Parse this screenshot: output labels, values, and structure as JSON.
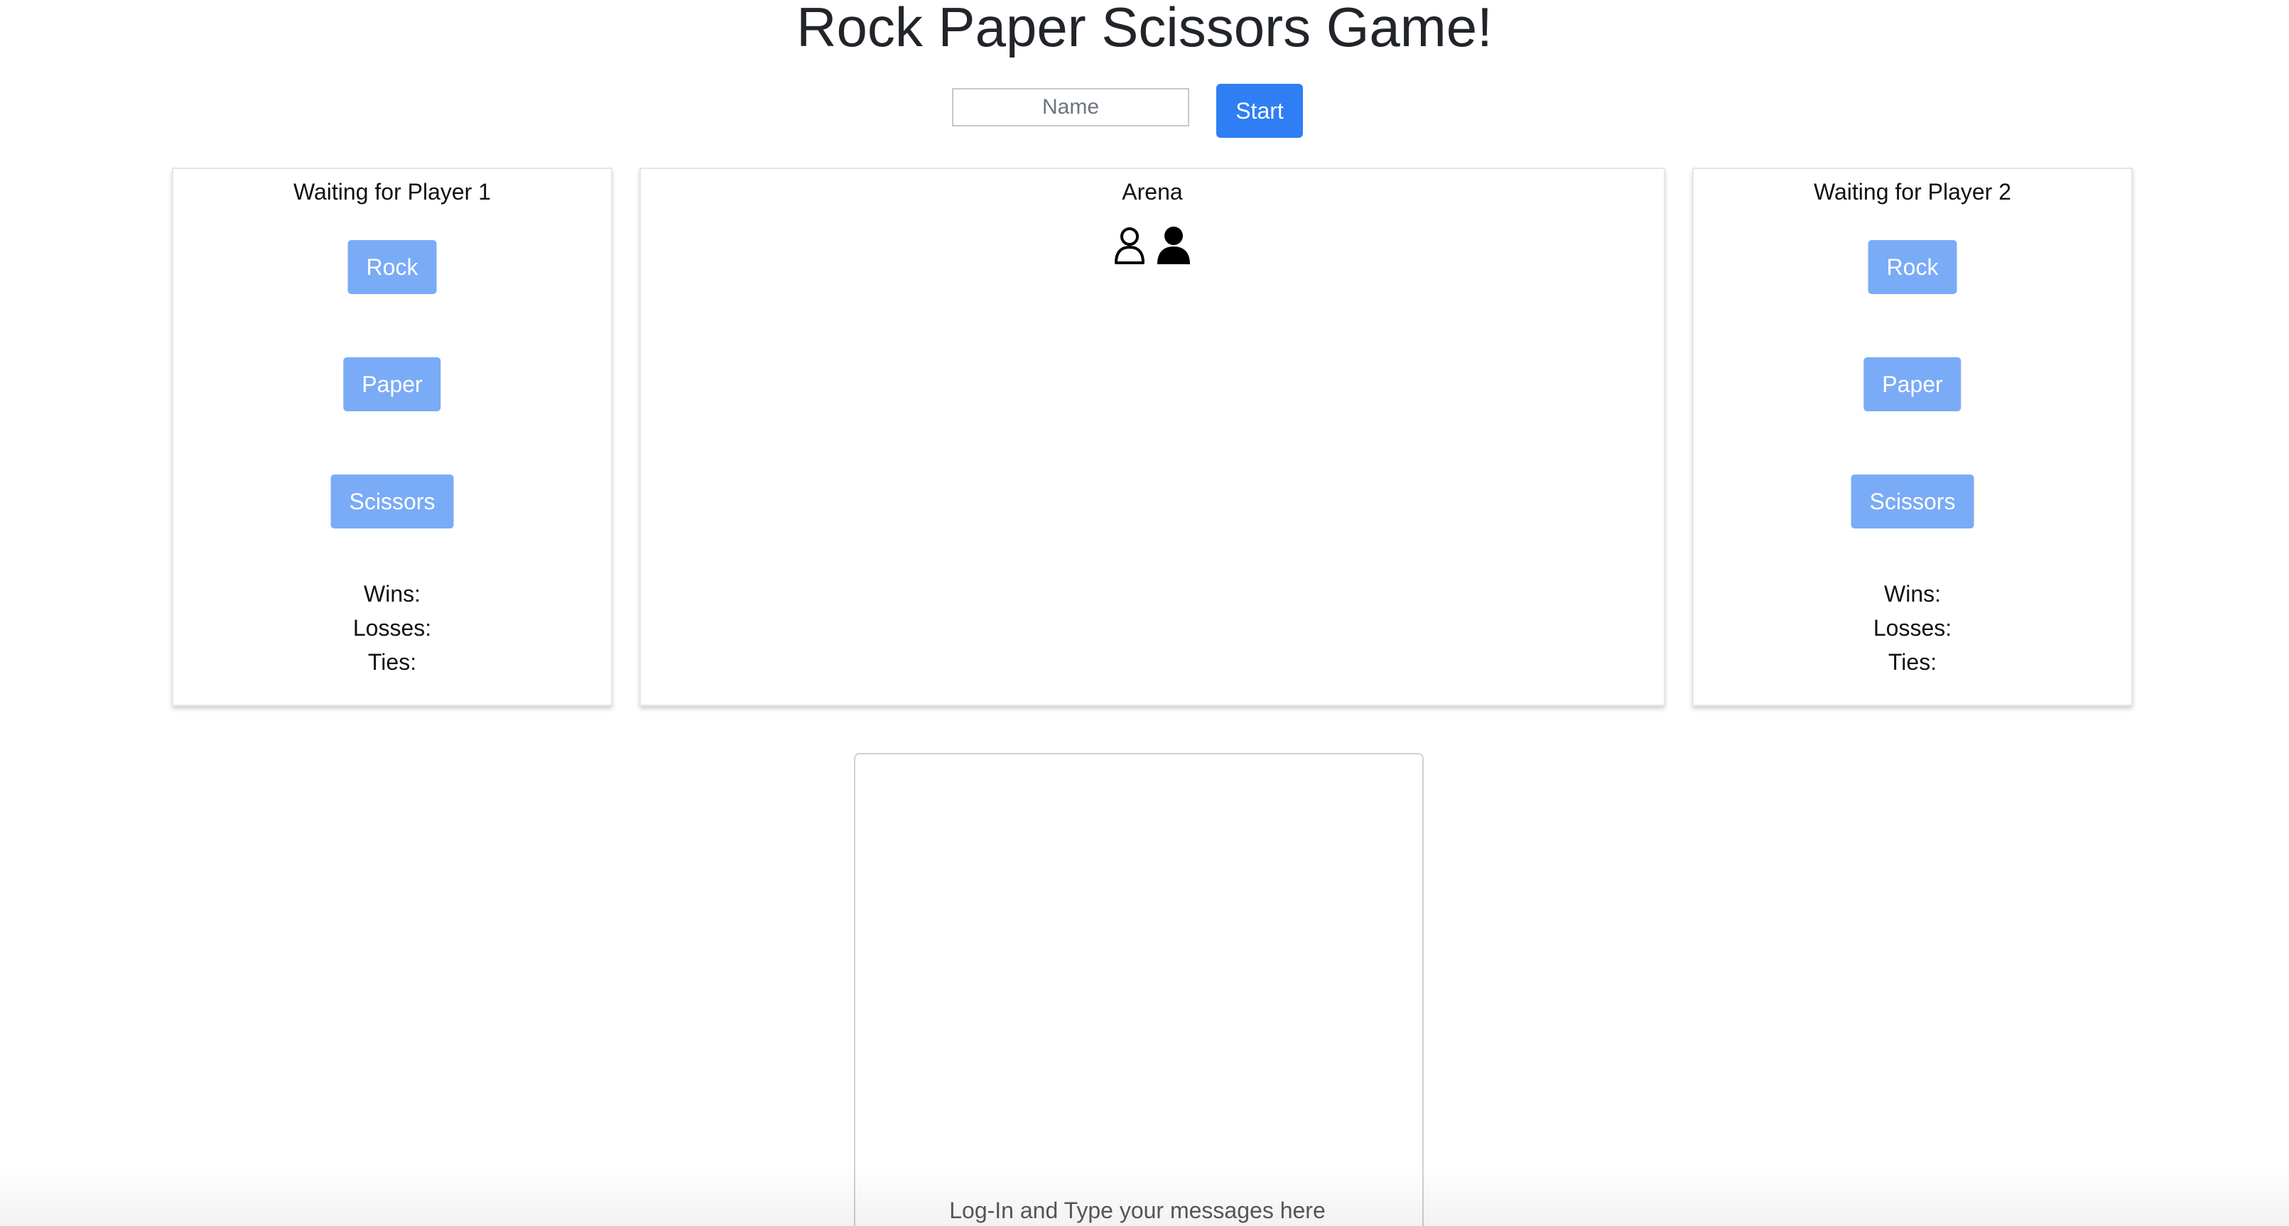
{
  "header": {
    "title": "Rock Paper Scissors Game!",
    "name_placeholder": "Name",
    "start_label": "Start"
  },
  "player1": {
    "status": "Waiting for Player 1",
    "moves": [
      "Rock",
      "Paper",
      "Scissors"
    ],
    "wins_label": "Wins:",
    "losses_label": "Losses:",
    "ties_label": "Ties:"
  },
  "arena": {
    "title": "Arena",
    "icons": [
      "user-outline-icon",
      "user-filled-icon"
    ]
  },
  "player2": {
    "status": "Waiting for Player 2",
    "moves": [
      "Rock",
      "Paper",
      "Scissors"
    ],
    "wins_label": "Wins:",
    "losses_label": "Losses:",
    "ties_label": "Ties:"
  },
  "chat": {
    "hint": "Log-In and Type your messages here"
  },
  "colors": {
    "primary_button": "#2f7ef4",
    "move_button": "#7aabf6",
    "panel_border": "#e6e6e6"
  }
}
